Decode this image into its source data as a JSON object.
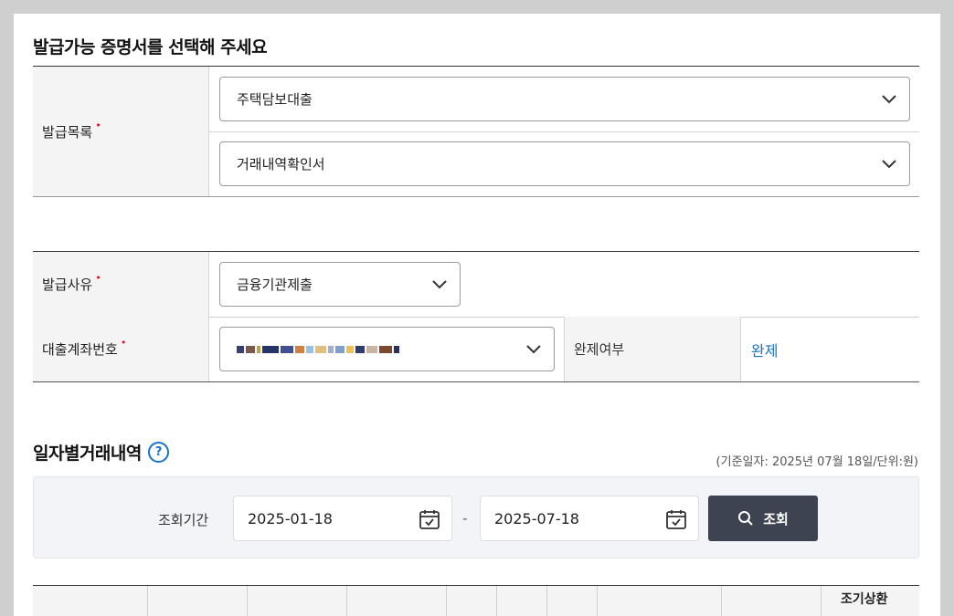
{
  "page_title": "발급가능 증명서를 선택해 주세요",
  "issue_list": {
    "label": "발급목록",
    "required_mark": "•",
    "select1": "주택담보대출",
    "select2": "거래내역확인서"
  },
  "issue_reason": {
    "label": "발급사유",
    "required_mark": "•",
    "value": "금융기관제출"
  },
  "loan_account": {
    "label": "대출계좌번호",
    "required_mark": "•",
    "value_masked": true,
    "paid_off_label": "완제여부",
    "paid_off_value": "완제"
  },
  "history": {
    "title": "일자별거래내역",
    "help_glyph": "?",
    "basis_note": "(기준일자: 2025년 07월 18일/단위:원)",
    "period_label": "조회기간",
    "start_date": "2025-01-18",
    "separator": "-",
    "end_date": "2025-07-18",
    "search_button": "조회",
    "table_partial_header": "조기상환"
  },
  "colors": {
    "accent_blue": "#1a73c6",
    "required_red": "#e0142c",
    "button_dark": "#3d4350"
  },
  "icons": [
    "chevron-down-icon",
    "calendar-icon",
    "search-icon",
    "help-icon"
  ]
}
